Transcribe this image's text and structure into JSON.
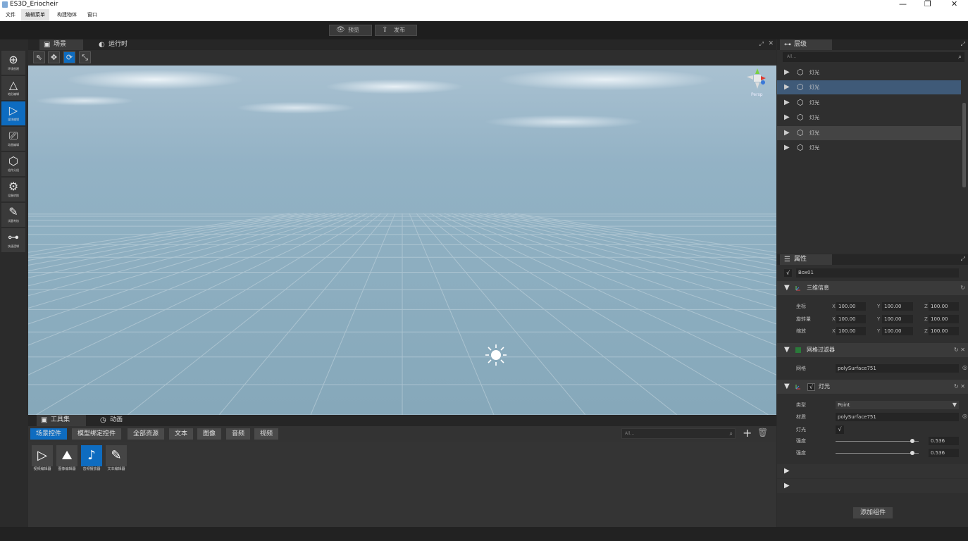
{
  "window": {
    "title": "ES3D_Eriocheir",
    "minimize": "—",
    "restore": "❐",
    "close": "✕"
  },
  "menu": [
    "文件",
    "编辑菜单",
    "构建物体",
    "窗口"
  ],
  "toolbar": {
    "preview": "预览",
    "publish": "发布"
  },
  "sidebar": [
    {
      "label": "环境创建",
      "icon": "add-shape-icon"
    },
    {
      "label": "地形编辑",
      "icon": "terrain-icon"
    },
    {
      "label": "媒体编辑",
      "icon": "media-icon"
    },
    {
      "label": "动画编辑",
      "icon": "animation-icon"
    },
    {
      "label": "组件分组",
      "icon": "cube-icon"
    },
    {
      "label": "设备转换",
      "icon": "gear-icon"
    },
    {
      "label": "试题考核",
      "icon": "edit-icon"
    },
    {
      "label": "快速逻辑",
      "icon": "flow-icon"
    }
  ],
  "scene": {
    "tab_scene": "场景",
    "tab_runtime": "运行时",
    "gizmo_label": "Persp"
  },
  "bottom": {
    "tab_toolset": "工具集",
    "tab_animation": "动画",
    "filters": [
      "场景控件",
      "模型绑定控件",
      "全部资源",
      "文本",
      "图像",
      "音频",
      "视频"
    ],
    "search_placeholder": "All...",
    "assets": [
      "视频编辑器",
      "图像编辑器",
      "音频播放器",
      "文本编辑器"
    ]
  },
  "hierarchy": {
    "title": "层级",
    "search_placeholder": "All...",
    "items": [
      "灯光",
      "灯光",
      "灯光",
      "灯光",
      "灯光",
      "灯光"
    ]
  },
  "properties": {
    "title": "属性",
    "object_name": "Box01",
    "check": "√",
    "transform": {
      "title": "三维信息",
      "rows": [
        {
          "label": "坐标",
          "x": "100.00",
          "y": "100.00",
          "z": "100.00"
        },
        {
          "label": "旋转量",
          "x": "100.00",
          "y": "100.00",
          "z": "100.00"
        },
        {
          "label": "缩放",
          "x": "100.00",
          "y": "100.00",
          "z": "100.00"
        }
      ],
      "axis_x": "X",
      "axis_y": "Y",
      "axis_z": "Z"
    },
    "mesh": {
      "title": "网格过滤器",
      "label": "网格",
      "value": "polySurface751"
    },
    "light": {
      "title": "灯光",
      "type_label": "类型",
      "type_value": "Point",
      "material_label": "材质",
      "material_value": "polySurface751",
      "light_label": "灯光",
      "light_value": "√",
      "intensity_label": "强度",
      "intensity_value": "0.536",
      "intensity_level": 0.92,
      "strength_label": "强度",
      "strength_value": "0.536",
      "strength_level": 0.92
    },
    "add_component": "添加组件"
  }
}
